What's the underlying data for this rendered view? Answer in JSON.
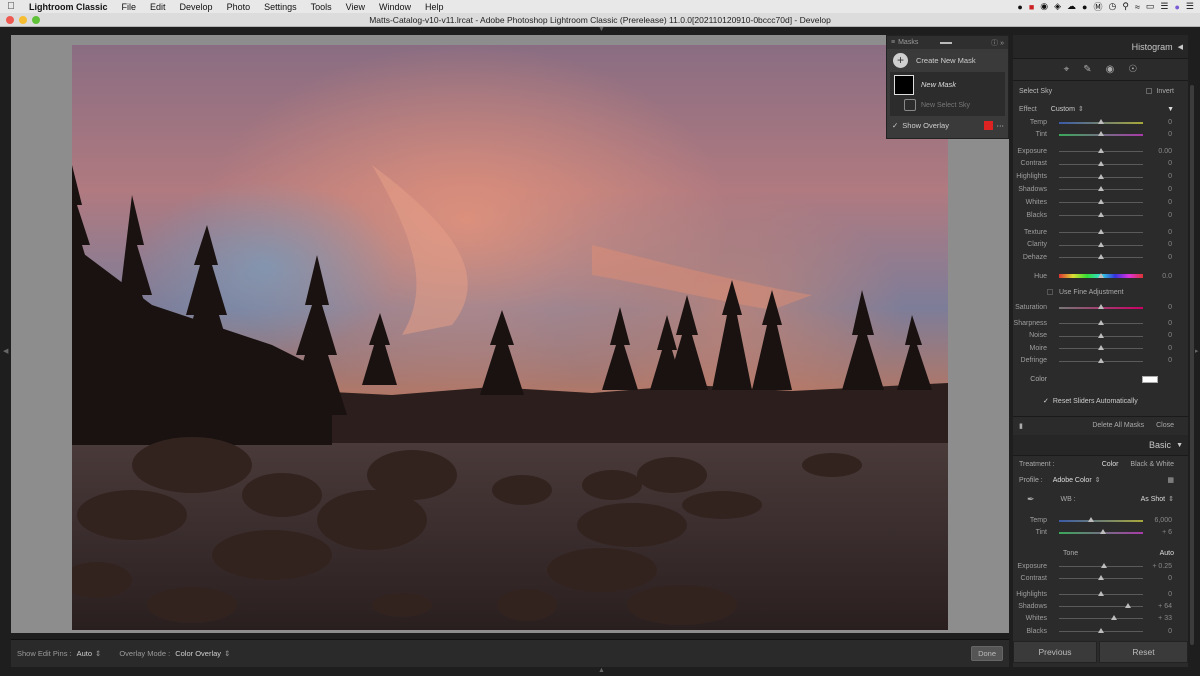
{
  "menubar": {
    "app_name": "Lightroom Classic",
    "items": [
      "File",
      "Edit",
      "Develop",
      "Photo",
      "Settings",
      "Tools",
      "View",
      "Window",
      "Help"
    ]
  },
  "window": {
    "title": "Matts-Catalog-v10-v11.lrcat - Adobe Photoshop Lightroom Classic (Prerelease) 11.0.0[202110120910-0bccc70d] - Develop"
  },
  "masks_panel": {
    "title": "Masks",
    "create_label": "Create New Mask",
    "mask_name": "New Mask",
    "sub_mask_name": "New Select Sky",
    "show_overlay_label": "Show Overlay",
    "overlay_color": "#d22a2a"
  },
  "right_panel": {
    "histogram_title": "Histogram",
    "mask_type": "Select Sky",
    "invert_label": "Invert",
    "effect_label": "Effect",
    "effect_value": "Custom",
    "color_label": "Color",
    "sliders_group1": [
      {
        "label": "Temp",
        "value": "0"
      },
      {
        "label": "Tint",
        "value": "0"
      }
    ],
    "sliders_group2": [
      {
        "label": "Exposure",
        "value": "0.00"
      },
      {
        "label": "Contrast",
        "value": "0"
      },
      {
        "label": "Highlights",
        "value": "0"
      },
      {
        "label": "Shadows",
        "value": "0"
      },
      {
        "label": "Whites",
        "value": "0"
      },
      {
        "label": "Blacks",
        "value": "0"
      }
    ],
    "sliders_group3": [
      {
        "label": "Texture",
        "value": "0"
      },
      {
        "label": "Clarity",
        "value": "0"
      },
      {
        "label": "Dehaze",
        "value": "0"
      }
    ],
    "hue": {
      "label": "Hue",
      "value": "0.0"
    },
    "fine_adjust_label": "Use Fine Adjustment",
    "saturation": {
      "label": "Saturation",
      "value": "0"
    },
    "sliders_group4": [
      {
        "label": "Sharpness",
        "value": "0"
      },
      {
        "label": "Noise",
        "value": "0"
      },
      {
        "label": "Moire",
        "value": "0"
      },
      {
        "label": "Defringe",
        "value": "0"
      }
    ],
    "reset_label": "Reset Sliders Automatically",
    "delete_all_label": "Delete All Masks",
    "close_label": "Close",
    "basic_title": "Basic",
    "treatment_label": "Treatment :",
    "treatment_color": "Color",
    "treatment_bw": "Black & White",
    "profile_label": "Profile :",
    "profile_value": "Adobe Color",
    "wb_label": "WB :",
    "wb_value": "As Shot",
    "wb_sliders": [
      {
        "label": "Temp",
        "value": "6,000"
      },
      {
        "label": "Tint",
        "value": "+ 6"
      }
    ],
    "tone_label": "Tone",
    "tone_auto": "Auto",
    "tone_sliders": [
      {
        "label": "Exposure",
        "value": "+ 0.25"
      },
      {
        "label": "Contrast",
        "value": "0"
      },
      {
        "label": "Highlights",
        "value": "0"
      },
      {
        "label": "Shadows",
        "value": "+ 64"
      },
      {
        "label": "Whites",
        "value": "+ 33"
      },
      {
        "label": "Blacks",
        "value": "0"
      }
    ],
    "previous_label": "Previous",
    "reset_btn_label": "Reset"
  },
  "toolbar": {
    "edit_pins_label": "Show Edit Pins :",
    "edit_pins_value": "Auto",
    "overlay_mode_label": "Overlay Mode :",
    "overlay_mode_value": "Color Overlay",
    "done_label": "Done"
  }
}
